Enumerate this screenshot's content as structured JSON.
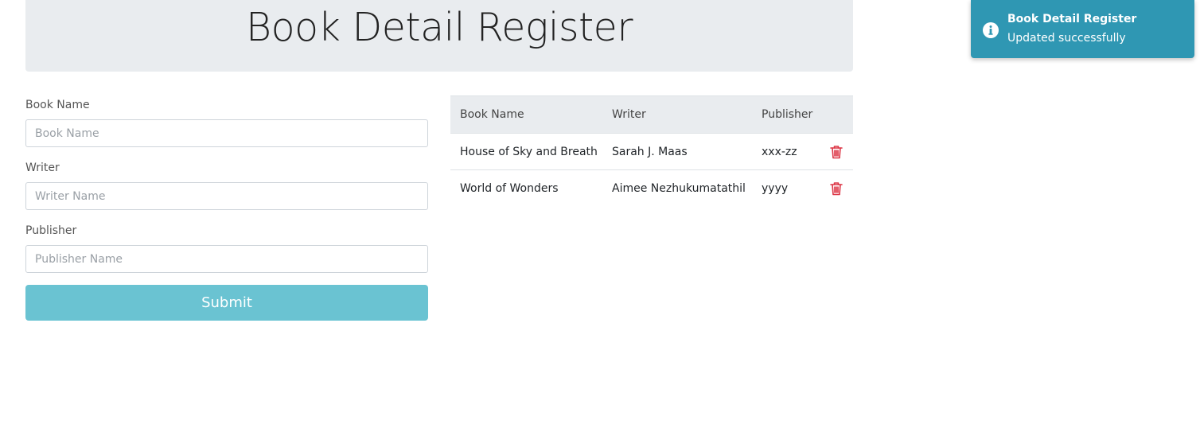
{
  "header": {
    "title": "Book Detail Register"
  },
  "form": {
    "book_name": {
      "label": "Book Name",
      "placeholder": "Book Name",
      "value": ""
    },
    "writer": {
      "label": "Writer",
      "placeholder": "Writer Name",
      "value": ""
    },
    "publisher": {
      "label": "Publisher",
      "placeholder": "Publisher Name",
      "value": ""
    },
    "submit_label": "Submit"
  },
  "table": {
    "columns": [
      "Book Name",
      "Writer",
      "Publisher"
    ],
    "rows": [
      {
        "book_name": "House of Sky and Breath",
        "writer": "Sarah J. Maas",
        "publisher": "xxx-zz",
        "action_icon": "trash-icon"
      },
      {
        "book_name": "World of Wonders",
        "writer": "Aimee Nezhukumatathil",
        "publisher": "yyyy",
        "action_icon": "trash-icon"
      }
    ]
  },
  "toast": {
    "icon": "info-icon",
    "title": "Book Detail Register",
    "message": "Updated successfully"
  },
  "colors": {
    "header_bg": "#e9ecef",
    "submit_bg": "#6ac3d2",
    "toast_bg": "#2f97b3",
    "delete_icon": "#dc3545"
  }
}
